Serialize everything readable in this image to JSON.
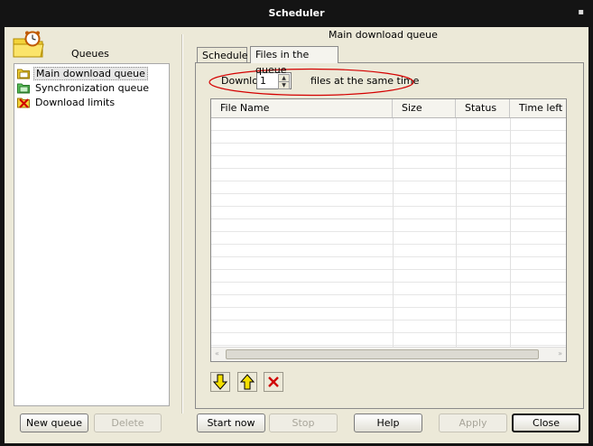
{
  "window": {
    "title": "Scheduler",
    "menu_glyph": "▪"
  },
  "sidebar": {
    "heading": "Queues",
    "items": [
      {
        "label": "Main download queue",
        "icon": "queue-folder-icon",
        "selected": true
      },
      {
        "label": "Synchronization queue",
        "icon": "sync-queue-icon",
        "selected": false
      },
      {
        "label": "Download limits",
        "icon": "download-limits-icon",
        "selected": false
      }
    ],
    "new_queue": "New queue",
    "delete": "Delete"
  },
  "main": {
    "title": "Main download queue",
    "tabs": [
      {
        "label": "Schedule",
        "active": false
      },
      {
        "label": "Files in the queue",
        "active": true
      }
    ],
    "download_prefix": "Download",
    "download_value": "1",
    "download_suffix": "files at the same time",
    "columns": [
      "File Name",
      "Size",
      "Status",
      "Time left"
    ],
    "scroll_left": "«",
    "scroll_right": "»"
  },
  "toolbar": {
    "move_down_icon": "arrow-down-icon",
    "move_up_icon": "arrow-up-icon",
    "remove_icon": "remove-icon"
  },
  "footer": {
    "start_now": "Start now",
    "stop": "Stop",
    "help": "Help",
    "apply": "Apply",
    "close": "Close"
  },
  "colors": {
    "highlight_ellipse": "#d40000",
    "arrow_yellow": "#f5e000",
    "remove_red": "#d00000",
    "title_bar": "#141414",
    "dialog_bg": "#ece9d8"
  }
}
